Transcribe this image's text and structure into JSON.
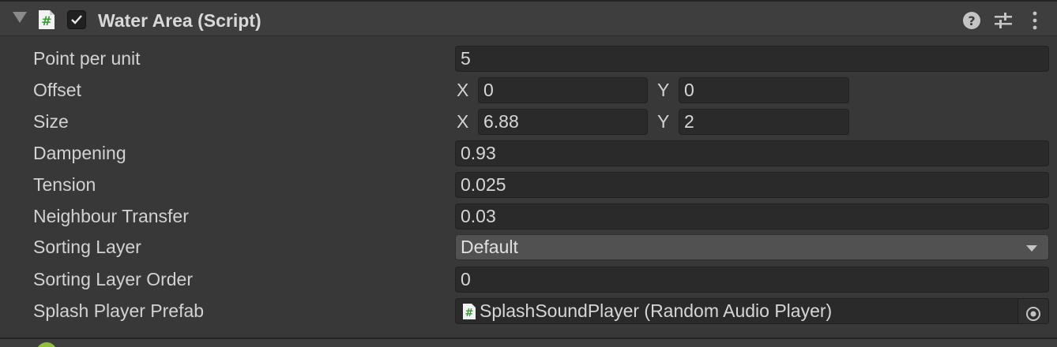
{
  "component": {
    "title": "Water Area (Script)",
    "enabled": true,
    "icons": {
      "foldout": "foldout-triangle-icon",
      "script": "script-hash-icon",
      "help": "help-icon",
      "presets": "presets-sliders-icon",
      "menu": "kebab-menu-icon"
    }
  },
  "fields": {
    "point_per_unit": {
      "label": "Point per unit",
      "value": "5"
    },
    "offset": {
      "label": "Offset",
      "x_label": "X",
      "x": "0",
      "y_label": "Y",
      "y": "0"
    },
    "size": {
      "label": "Size",
      "x_label": "X",
      "x": "6.88",
      "y_label": "Y",
      "y": "2"
    },
    "dampening": {
      "label": "Dampening",
      "value": "0.93"
    },
    "tension": {
      "label": "Tension",
      "value": "0.025"
    },
    "neighbour_transfer": {
      "label": "Neighbour Transfer",
      "value": "0.03"
    },
    "sorting_layer": {
      "label": "Sorting Layer",
      "value": "Default"
    },
    "sorting_layer_order": {
      "label": "Sorting Layer Order",
      "value": "0"
    },
    "splash_player_prefab": {
      "label": "Splash Player Prefab",
      "value": "SplashSoundPlayer (Random Audio Player)"
    }
  },
  "colors": {
    "background": "#383838",
    "field": "#2a2a2a",
    "script_icon": "#4fa84f",
    "text": "#d2d2d2"
  }
}
